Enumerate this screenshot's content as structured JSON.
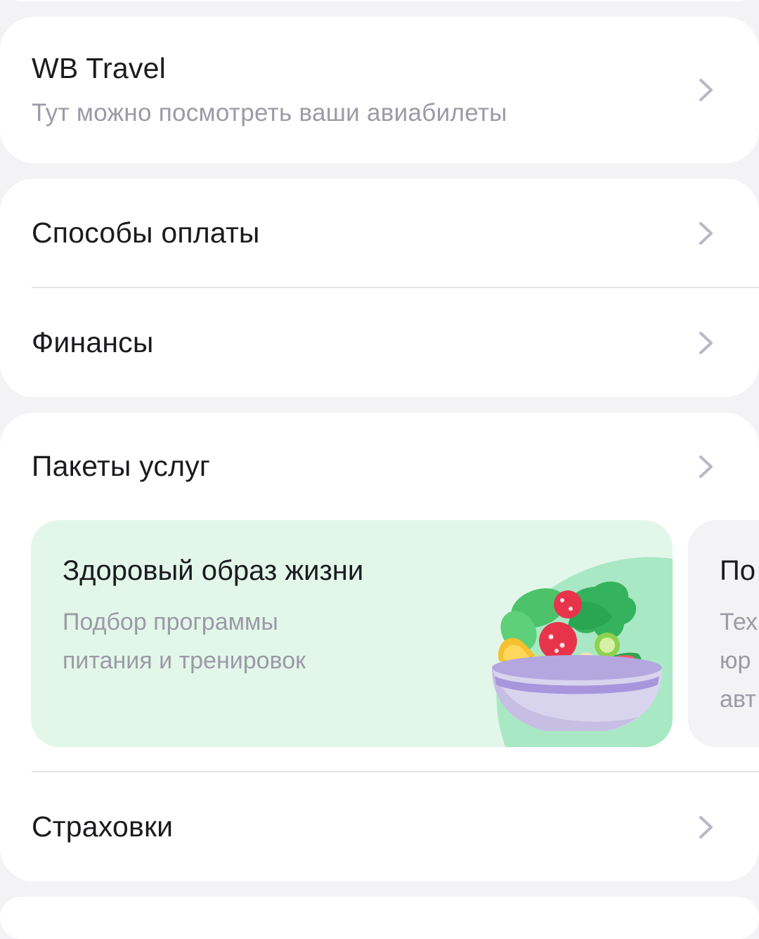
{
  "travel": {
    "title": "WB Travel",
    "subtitle": "Тут можно посмотреть ваши авиабилеты"
  },
  "payments": {
    "methods_label": "Способы оплаты",
    "finance_label": "Финансы"
  },
  "services": {
    "title": "Пакеты услуг",
    "packages": [
      {
        "title": "Здоровый образ жизни",
        "description": "Подбор программы\nпитания и тренировок",
        "illustration": "salad-bowl-icon"
      },
      {
        "title": "По",
        "description": "Тех\nюр\nавт"
      }
    ],
    "insurance_label": "Страховки"
  },
  "colors": {
    "background": "#f3f3f5",
    "card": "#ffffff",
    "health_card": "#e3f6ea",
    "health_accent": "#a9e8c4",
    "secondary_text": "#9b9aa6",
    "chevron": "#b9b8c6"
  }
}
